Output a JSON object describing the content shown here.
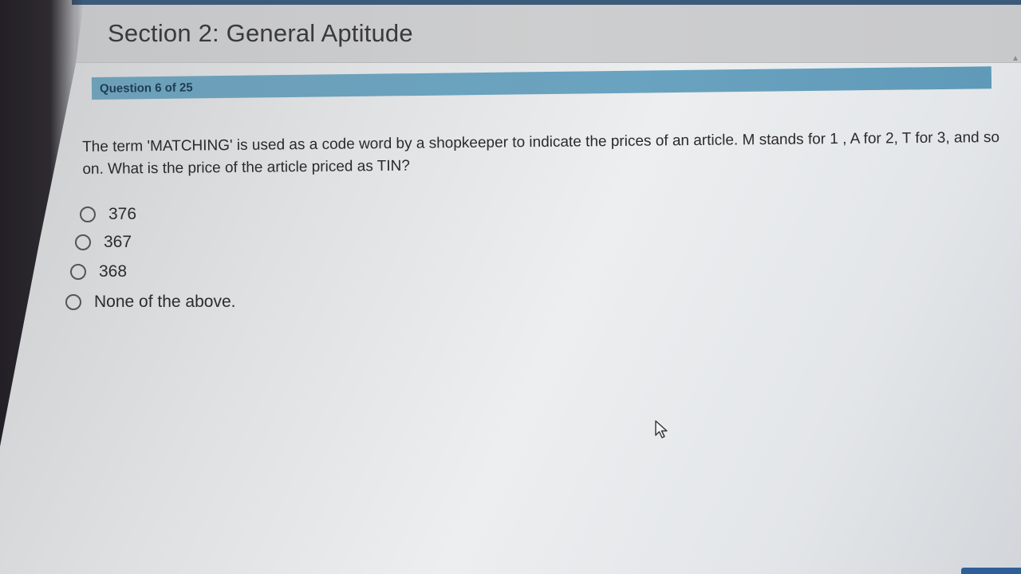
{
  "section": {
    "title": "Section 2: General Aptitude"
  },
  "question": {
    "counter": "Question 6 of 25",
    "text": "The term 'MATCHING' is used as a code word by a shopkeeper to indicate the prices of an article. M stands for 1 , A for 2, T for 3, and so on. What is the price of the article priced as TIN?"
  },
  "options": [
    {
      "label": "376",
      "selected": false
    },
    {
      "label": "367",
      "selected": false
    },
    {
      "label": "368",
      "selected": false
    },
    {
      "label": "None of the above.",
      "selected": false
    }
  ],
  "icons": {
    "cursor": "mouse-pointer-icon",
    "radio": "radio-button-icon"
  },
  "colors": {
    "question_bar": "#6aa3c0",
    "question_counter": "#1f3d55",
    "header_bg": "#c9cacc",
    "accent": "#2f5f9a"
  }
}
